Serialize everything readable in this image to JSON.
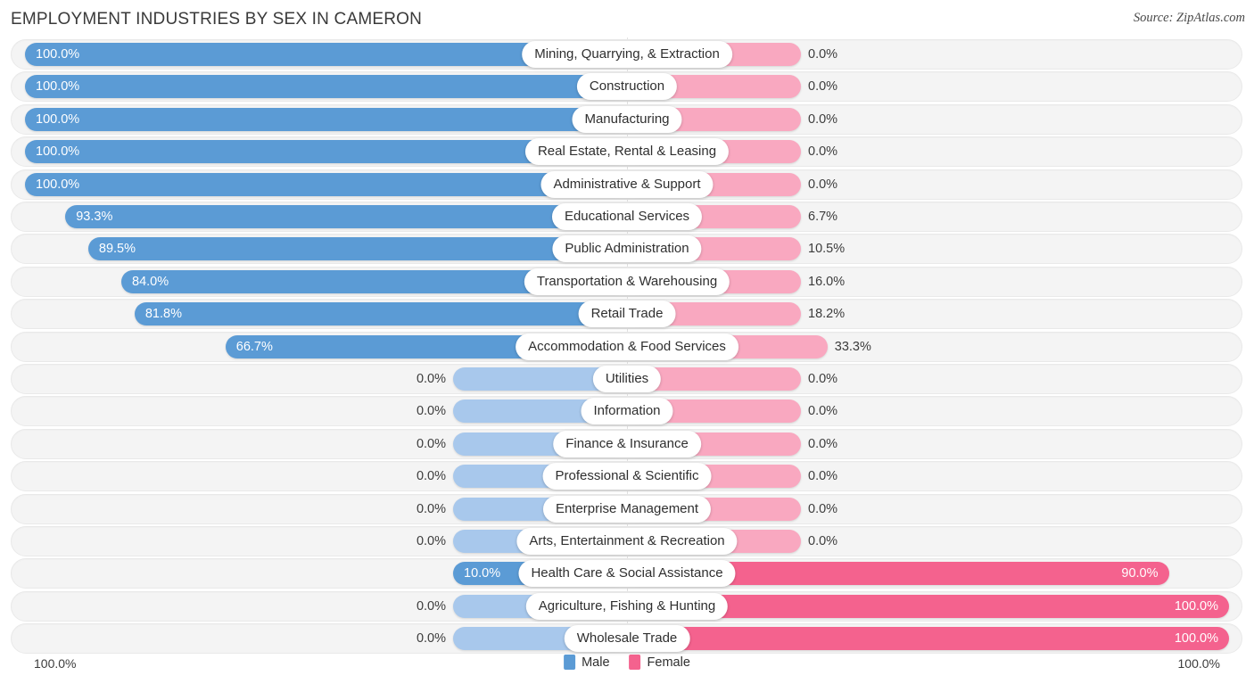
{
  "header": {
    "title": "EMPLOYMENT INDUSTRIES BY SEX IN CAMERON",
    "source": "Source: ZipAtlas.com"
  },
  "legend": {
    "male_label": "Male",
    "female_label": "Female"
  },
  "axis": {
    "left_label": "100.0%",
    "right_label": "100.0%"
  },
  "colors": {
    "male": "#5b9bd5",
    "male_zero": "#a8c8ec",
    "female": "#f9a8c0",
    "female_high": "#f4628e",
    "track": "#f4f4f4"
  },
  "chart_data": {
    "type": "bar",
    "title": "EMPLOYMENT INDUSTRIES BY SEX IN CAMERON",
    "subtitle": "Source: ZipAtlas.com",
    "orientation": "horizontal-diverging",
    "xlabel": "",
    "ylabel": "",
    "xlim": [
      0,
      100
    ],
    "grid": false,
    "legend_position": "bottom-center",
    "categories": [
      "Mining, Quarrying, & Extraction",
      "Construction",
      "Manufacturing",
      "Real Estate, Rental & Leasing",
      "Administrative & Support",
      "Educational Services",
      "Public Administration",
      "Transportation & Warehousing",
      "Retail Trade",
      "Accommodation & Food Services",
      "Utilities",
      "Information",
      "Finance & Insurance",
      "Professional & Scientific",
      "Enterprise Management",
      "Arts, Entertainment & Recreation",
      "Health Care & Social Assistance",
      "Agriculture, Fishing & Hunting",
      "Wholesale Trade"
    ],
    "series": [
      {
        "name": "Male",
        "values": [
          100.0,
          100.0,
          100.0,
          100.0,
          100.0,
          93.3,
          89.5,
          84.0,
          81.8,
          66.7,
          0.0,
          0.0,
          0.0,
          0.0,
          0.0,
          0.0,
          10.0,
          0.0,
          0.0
        ],
        "labels": [
          "100.0%",
          "100.0%",
          "100.0%",
          "100.0%",
          "100.0%",
          "93.3%",
          "89.5%",
          "84.0%",
          "81.8%",
          "66.7%",
          "0.0%",
          "0.0%",
          "0.0%",
          "0.0%",
          "0.0%",
          "0.0%",
          "10.0%",
          "0.0%",
          "0.0%"
        ]
      },
      {
        "name": "Female",
        "values": [
          0.0,
          0.0,
          0.0,
          0.0,
          0.0,
          6.7,
          10.5,
          16.0,
          18.2,
          33.3,
          0.0,
          0.0,
          0.0,
          0.0,
          0.0,
          0.0,
          90.0,
          100.0,
          100.0
        ],
        "labels": [
          "0.0%",
          "0.0%",
          "0.0%",
          "0.0%",
          "0.0%",
          "6.7%",
          "10.5%",
          "16.0%",
          "18.2%",
          "33.3%",
          "0.0%",
          "0.0%",
          "0.0%",
          "0.0%",
          "0.0%",
          "0.0%",
          "90.0%",
          "100.0%",
          "100.0%"
        ]
      }
    ]
  }
}
